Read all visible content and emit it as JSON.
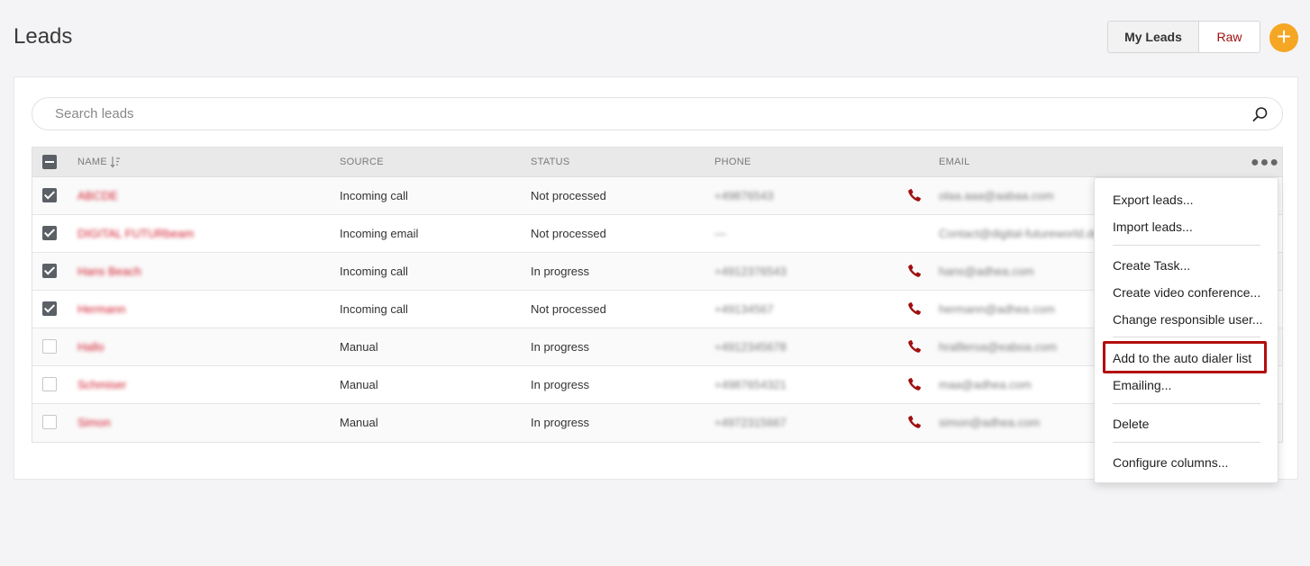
{
  "header": {
    "title": "Leads",
    "segments": [
      "My Leads",
      "Raw"
    ],
    "add_label": "+"
  },
  "search": {
    "placeholder": "Search leads",
    "value": ""
  },
  "table": {
    "columns": [
      "NAME",
      "SOURCE",
      "STATUS",
      "PHONE",
      "EMAIL"
    ],
    "rows": [
      {
        "checked": true,
        "name": "ABCDE",
        "source": "Incoming call",
        "status": "Not processed",
        "phone": "+49876543",
        "has_phone_icon": true,
        "email": "olaa.aaa@aabaa.com"
      },
      {
        "checked": true,
        "name": "DIGITAL FUTURbeam",
        "source": "Incoming email",
        "status": "Not processed",
        "phone": "—",
        "has_phone_icon": false,
        "email": "Contact@digital-futureworld.de"
      },
      {
        "checked": true,
        "name": "Hans Beach",
        "source": "Incoming call",
        "status": "In progress",
        "phone": "+4912376543",
        "has_phone_icon": true,
        "email": "hans@adhea.com"
      },
      {
        "checked": true,
        "name": "Hermann",
        "source": "Incoming call",
        "status": "Not processed",
        "phone": "+49134567",
        "has_phone_icon": true,
        "email": "hermann@adhea.com"
      },
      {
        "checked": false,
        "name": "Hallo",
        "source": "Manual",
        "status": "In progress",
        "phone": "+4912345678",
        "has_phone_icon": true,
        "email": "hrallleroa@eaboa.com"
      },
      {
        "checked": false,
        "name": "Schmiser",
        "source": "Manual",
        "status": "In progress",
        "phone": "+4987654321",
        "has_phone_icon": true,
        "email": "maa@adhea.com"
      },
      {
        "checked": false,
        "name": "Simon",
        "source": "Manual",
        "status": "In progress",
        "phone": "+4972315667",
        "has_phone_icon": true,
        "email": "simon@adhea.com"
      }
    ]
  },
  "menu": {
    "items": [
      "Export leads...",
      "Import leads...",
      "Create Task...",
      "Create video conference...",
      "Change responsible user...",
      "Add to the auto dialer list",
      "Emailing...",
      "Delete",
      "Configure columns..."
    ]
  },
  "colors": {
    "accent_orange": "#f5a623",
    "phone_red": "#a01010",
    "highlight_red": "#b30d0d"
  },
  "icons": {
    "search": "search-icon",
    "sort": "sort-icon",
    "phone": "phone-icon",
    "more": "more-icon",
    "add": "plus-icon"
  }
}
